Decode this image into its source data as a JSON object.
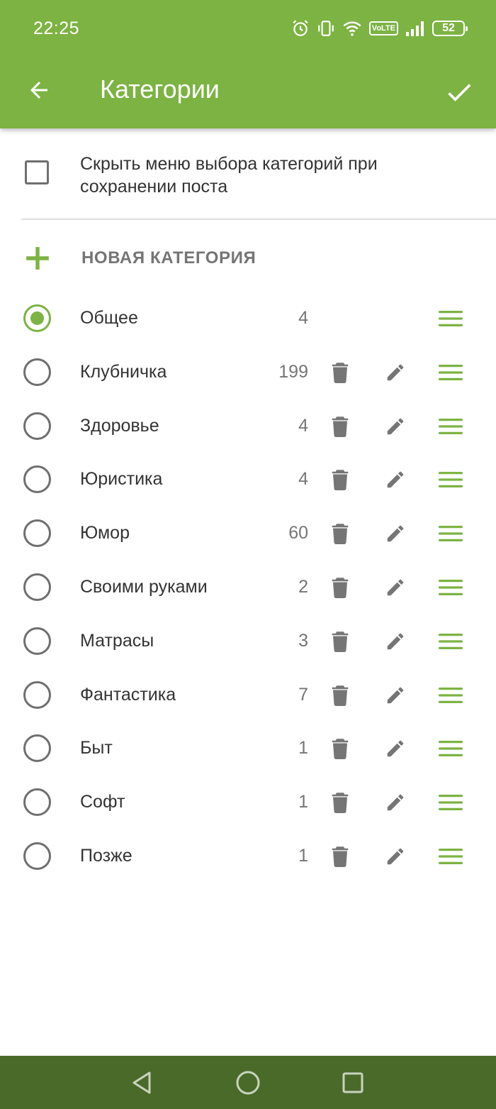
{
  "status_bar": {
    "time": "22:25",
    "volte": "VoLTE",
    "battery": "52"
  },
  "toolbar": {
    "title": "Категории",
    "back_icon": "arrow-left-icon",
    "confirm_icon": "check-icon"
  },
  "settings": {
    "hide_menu_label": "Скрыть меню выбора категорий при сохранении поста",
    "hide_menu_checked": false
  },
  "new_category": {
    "label": "НОВАЯ КАТЕГОРИЯ"
  },
  "categories": [
    {
      "name": "Общее",
      "count": "4",
      "selected": true,
      "deletable": false
    },
    {
      "name": "Клубничка",
      "count": "199",
      "selected": false,
      "deletable": true
    },
    {
      "name": "Здоровье",
      "count": "4",
      "selected": false,
      "deletable": true
    },
    {
      "name": "Юристика",
      "count": "4",
      "selected": false,
      "deletable": true
    },
    {
      "name": "Юмор",
      "count": "60",
      "selected": false,
      "deletable": true
    },
    {
      "name": "Своими руками",
      "count": "2",
      "selected": false,
      "deletable": true
    },
    {
      "name": "Матрасы",
      "count": "3",
      "selected": false,
      "deletable": true
    },
    {
      "name": "Фантастика",
      "count": "7",
      "selected": false,
      "deletable": true
    },
    {
      "name": "Быт",
      "count": "1",
      "selected": false,
      "deletable": true
    },
    {
      "name": "Софт",
      "count": "1",
      "selected": false,
      "deletable": true
    },
    {
      "name": "Позже",
      "count": "1",
      "selected": false,
      "deletable": true
    }
  ],
  "colors": {
    "accent": "#7cb342",
    "nav_bar": "#4a6a2a",
    "icon_gray": "#6f6f6f"
  }
}
